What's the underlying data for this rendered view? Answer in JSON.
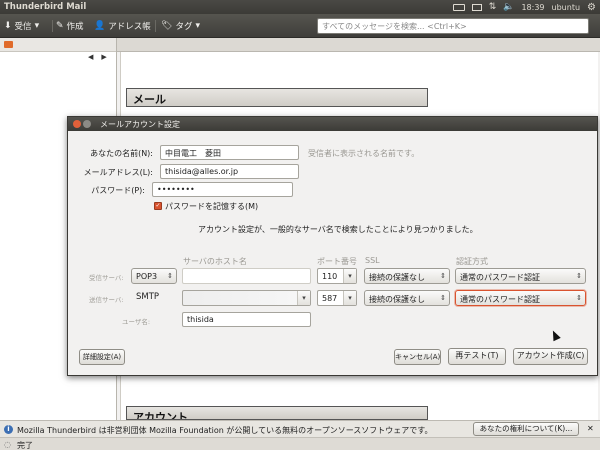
{
  "panel": {
    "app_title": "Thunderbird Mail",
    "time": "18:39",
    "user": "ubuntu",
    "icons": [
      "keyboard-icon",
      "mail-icon",
      "network-icon",
      "volume-icon",
      "gear-icon"
    ]
  },
  "toolbar": {
    "get_mail": "受信",
    "write": "作成",
    "address_book": "アドレス帳",
    "tag": "タグ",
    "search_placeholder": "すべてのメッセージを検索... <Ctrl+K>"
  },
  "content": {
    "mail_heading": "メール",
    "accounts_heading": "アカウント"
  },
  "dialog": {
    "title": "メールアカウント設定",
    "name_label": "あなたの名前(N):",
    "name_value": "中目電工　菱田",
    "name_hint": "受信者に表示される名前です。",
    "email_label": "メールアドレス(L):",
    "email_value": "thisida@alles.or.jp",
    "password_label": "パスワード(P):",
    "password_value": "••••••••",
    "remember_label": "パスワードを記憶する(M)",
    "remember_checked": true,
    "info_message": "アカウント設定が、一般的なサーバ名で検索したことにより見つかりました。",
    "columns": {
      "host": "サーバのホスト名",
      "port": "ポート番号",
      "ssl": "SSL",
      "auth": "認証方式"
    },
    "incoming": {
      "label": "受信サーバ:",
      "protocol": "POP3",
      "host": "",
      "port": "110",
      "ssl": "接続の保護なし",
      "auth": "通常のパスワード認証"
    },
    "outgoing": {
      "label": "送信サーバ:",
      "protocol": "SMTP",
      "host": "",
      "port": "587",
      "ssl": "接続の保護なし",
      "auth": "通常のパスワード認証"
    },
    "username_label": "ユーザ名:",
    "username_value": "thisida",
    "buttons": {
      "advanced": "詳細設定(A)",
      "cancel": "キャンセル(A)",
      "retest": "再テスト(T)",
      "create": "アカウント作成(C)"
    }
  },
  "notice": {
    "text": "Mozilla Thunderbird は非営利団体 Mozilla Foundation が公開している無料のオープンソースソフトウェアです。",
    "rights_button": "あなたの権利について(K)...",
    "close": "✕"
  },
  "status": {
    "text": "完了"
  }
}
